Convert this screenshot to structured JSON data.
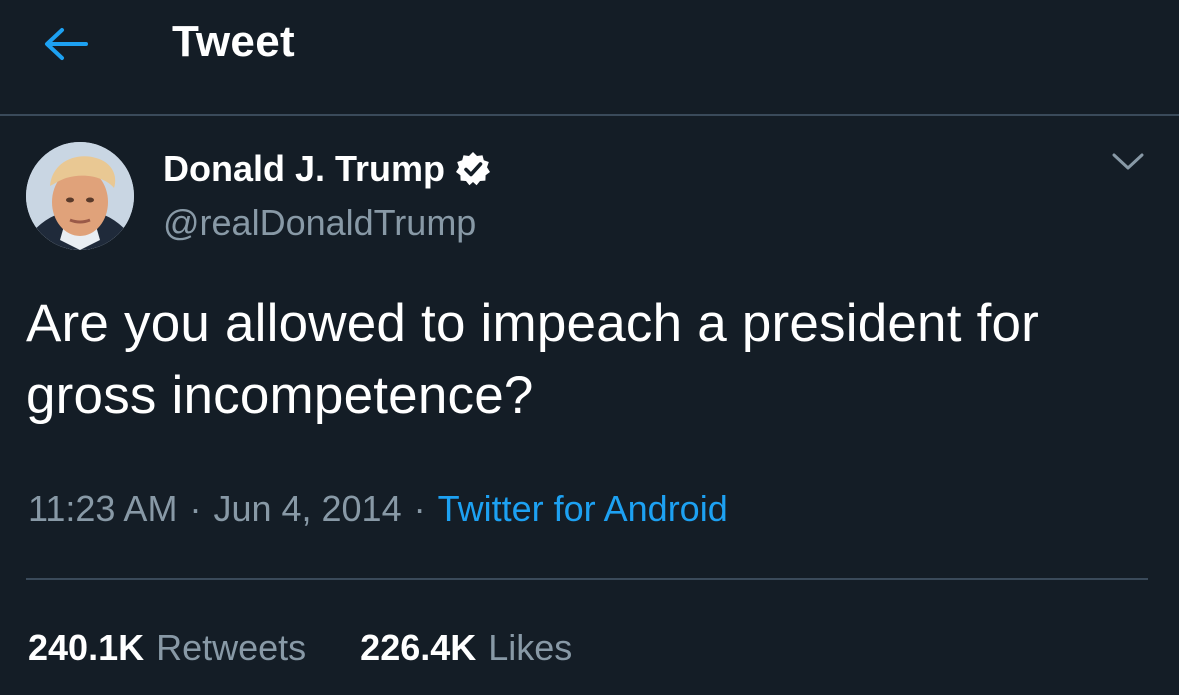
{
  "header": {
    "title": "Tweet",
    "back_icon": "arrow-left-icon"
  },
  "colors": {
    "background": "#141d26",
    "accent": "#1da1f2",
    "secondary_text": "#8899a6",
    "divider": "#3a4a5a"
  },
  "tweet": {
    "author": {
      "name": "Donald J. Trump",
      "handle": "@realDonaldTrump",
      "verified": true,
      "verified_icon": "verified-badge-icon"
    },
    "menu_icon": "chevron-down-icon",
    "text": "Are you allowed to impeach a president for gross incompetence?",
    "meta": {
      "time": "11:23 AM",
      "separator": "·",
      "date": "Jun 4, 2014",
      "source": "Twitter for Android"
    },
    "stats": {
      "retweets_count": "240.1K",
      "retweets_label": "Retweets",
      "likes_count": "226.4K",
      "likes_label": "Likes"
    }
  }
}
